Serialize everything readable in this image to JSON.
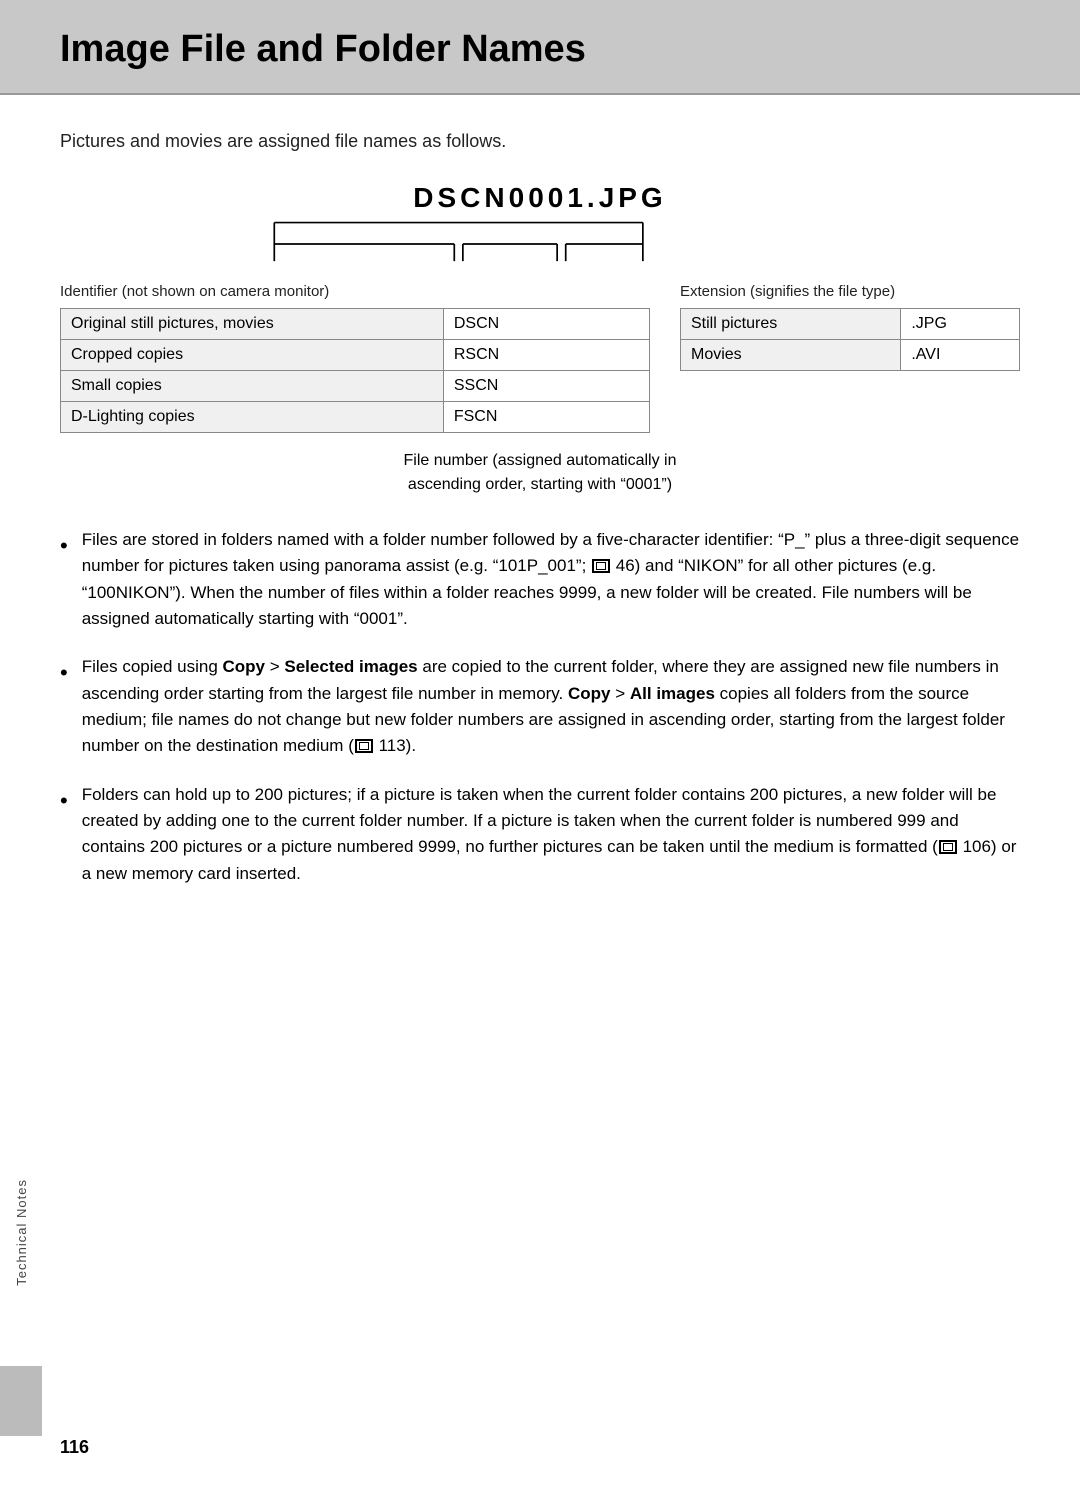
{
  "page": {
    "title": "Image File and Folder Names",
    "page_number": "116",
    "side_label": "Technical Notes"
  },
  "intro": {
    "text": "Pictures and movies are assigned file names as follows."
  },
  "filename": {
    "display": "DSCN0001.JPG"
  },
  "identifier_label": "Identifier (not shown on camera monitor)",
  "extension_label": "Extension (signifies the file type)",
  "identifier_table": {
    "rows": [
      {
        "label": "Original still pictures, movies",
        "code": "DSCN"
      },
      {
        "label": "Cropped copies",
        "code": "RSCN"
      },
      {
        "label": "Small copies",
        "code": "SSCN"
      },
      {
        "label": "D-Lighting copies",
        "code": "FSCN"
      }
    ]
  },
  "extension_table": {
    "rows": [
      {
        "label": "Still pictures",
        "value": ".JPG"
      },
      {
        "label": "Movies",
        "value": ".AVI"
      }
    ]
  },
  "file_number_note": {
    "line1": "File number (assigned automatically in",
    "line2": "ascending order, starting with “0001”)"
  },
  "bullets": [
    {
      "id": 1,
      "text_parts": [
        {
          "type": "normal",
          "text": "Files are stored in folders named with a folder number followed by a five-character identifier: “P_” plus a three-digit sequence number for pictures taken using panorama assist (e.g. “101P_001”; "
        },
        {
          "type": "icon"
        },
        {
          "type": "normal",
          "text": " 46) and “NIKON” for all other pictures (e.g. “100NIKON”). When the number of files within a folder reaches 9999, a new folder will be created. File numbers will be assigned automatically starting with “0001”."
        }
      ]
    },
    {
      "id": 2,
      "text_parts": [
        {
          "type": "normal",
          "text": "Files copied using "
        },
        {
          "type": "bold",
          "text": "Copy"
        },
        {
          "type": "normal",
          "text": " > "
        },
        {
          "type": "bold",
          "text": "Selected images"
        },
        {
          "type": "normal",
          "text": " are copied to the current folder, where they are assigned new file numbers in ascending order starting from the largest file number in memory. "
        },
        {
          "type": "bold",
          "text": "Copy"
        },
        {
          "type": "normal",
          "text": " > "
        },
        {
          "type": "bold",
          "text": "All images"
        },
        {
          "type": "normal",
          "text": " copies all folders from the source medium; file names do not change but new folder numbers are assigned in ascending order, starting from the largest folder number on the destination medium ("
        },
        {
          "type": "icon"
        },
        {
          "type": "normal",
          "text": " 113)."
        }
      ]
    },
    {
      "id": 3,
      "text_parts": [
        {
          "type": "normal",
          "text": "Folders can hold up to 200 pictures; if a picture is taken when the current folder contains 200 pictures, a new folder will be created by adding one to the current folder number. If a picture is taken when the current folder is numbered 999 and contains 200 pictures or a picture numbered 9999, no further pictures can be taken until the medium is formatted ("
        },
        {
          "type": "icon"
        },
        {
          "type": "normal",
          "text": " 106) or a new memory card inserted."
        }
      ]
    }
  ]
}
